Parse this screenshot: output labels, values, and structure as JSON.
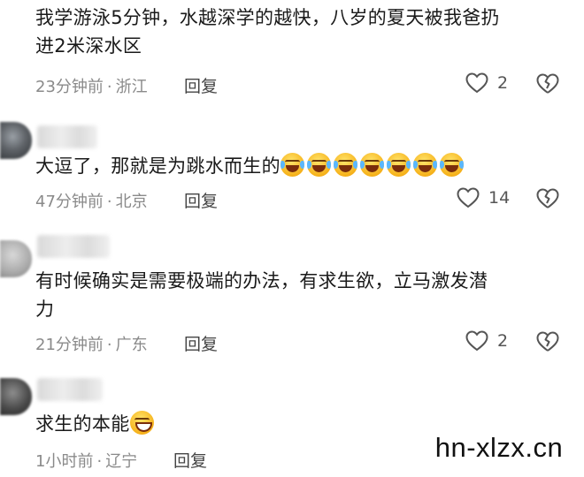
{
  "comments": [
    {
      "text_line1": "我学游泳5分钟，水越深学的越快，八岁的夏天被我爸扔",
      "text_line2": "进2米深水区",
      "time": "23分钟前",
      "location": "浙江",
      "reply_label": "回复",
      "likes": "2",
      "emoji_count": 0
    },
    {
      "text_line1": "大逗了，那就是为跳水而生的",
      "text_line2": "",
      "time": "47分钟前",
      "location": "北京",
      "reply_label": "回复",
      "likes": "14",
      "emoji": "rolling-laugh-emoji",
      "emoji_count": 7
    },
    {
      "text_line1": "有时候确实是需要极端的办法，有求生欲，立马激发潜",
      "text_line2": "力",
      "time": "21分钟前",
      "location": "广东",
      "reply_label": "回复",
      "likes": "2",
      "emoji_count": 0
    },
    {
      "text_line1": "求生的本能",
      "text_line2": "",
      "time": "1小时前",
      "location": "辽宁",
      "reply_label": "回复",
      "likes": "",
      "emoji": "grin-emoji",
      "emoji_count": 1
    }
  ],
  "separator": "·",
  "watermark": "hn-xlzx.cn",
  "icons": {
    "like": "heart-outline-icon",
    "dislike": "broken-heart-icon"
  },
  "colors": {
    "text": "#1a1a1a",
    "meta": "#8a8a8a",
    "icon": "#555555"
  }
}
